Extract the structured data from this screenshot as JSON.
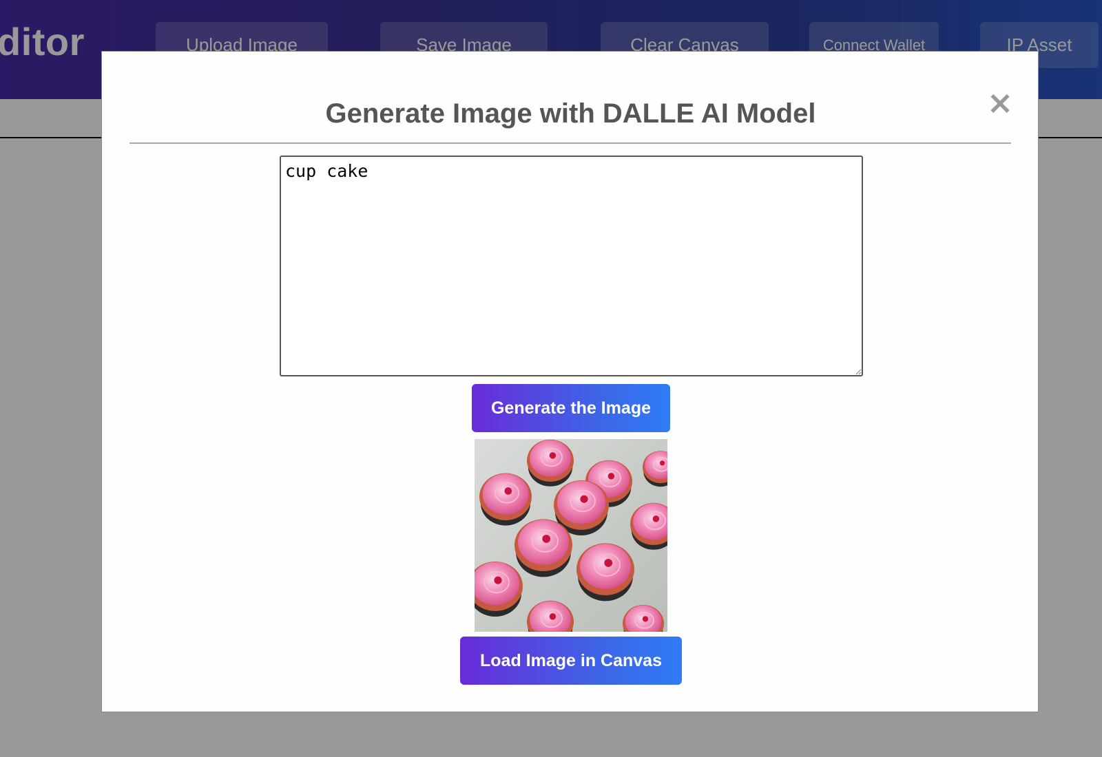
{
  "app": {
    "title_fragment": "ditor",
    "nav": {
      "upload": "Upload Image",
      "save": "Save Image",
      "clear": "Clear Canvas",
      "wallet": "Connect Wallet",
      "ip": "IP Asset"
    }
  },
  "modal": {
    "title": "Generate Image with DALLE AI Model",
    "close_glyph": "×",
    "prompt_value": "cup cake",
    "generate_label": "Generate the Image",
    "load_label": "Load Image in Canvas",
    "image_alt": "Generated cupcakes image"
  },
  "colors": {
    "header_gradient_start": "#4a2aa8",
    "header_gradient_end": "#2a55c6",
    "button_gradient_start": "#6a2bd8",
    "button_gradient_end": "#2f7cf4",
    "frosting_pink": "#ef86b4",
    "cupcake_liner": "#2b2b2b"
  }
}
